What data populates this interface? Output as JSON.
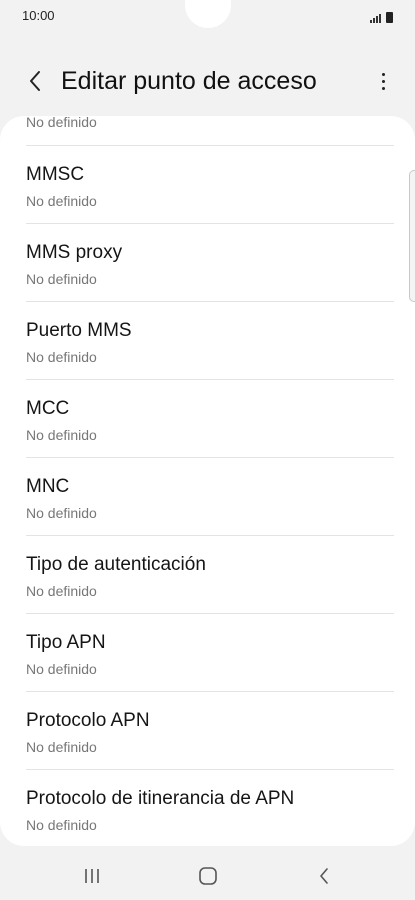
{
  "status_bar": {
    "time": "10:00"
  },
  "header": {
    "title": "Editar punto de acceso"
  },
  "settings": {
    "partial_item_value": "No definido",
    "items": [
      {
        "label": "MMSC",
        "value": "No definido"
      },
      {
        "label": "MMS proxy",
        "value": "No definido"
      },
      {
        "label": "Puerto MMS",
        "value": "No definido"
      },
      {
        "label": "MCC",
        "value": "No definido"
      },
      {
        "label": "MNC",
        "value": "No definido"
      },
      {
        "label": "Tipo de autenticación",
        "value": "No definido"
      },
      {
        "label": "Tipo APN",
        "value": "No definido"
      },
      {
        "label": "Protocolo APN",
        "value": "No definido"
      },
      {
        "label": "Protocolo de itinerancia de APN",
        "value": "No definido"
      }
    ]
  },
  "icons": {
    "back": "back-arrow-icon",
    "more": "more-options-icon",
    "signal": "signal-icon",
    "battery": "battery-icon",
    "nav_recents": "recent-apps-icon",
    "nav_home": "home-icon",
    "nav_back": "nav-back-icon"
  },
  "colors": {
    "background": "#f2f2f2",
    "card": "#ffffff",
    "divider": "#e3e3e3",
    "secondary_text": "#777777"
  }
}
